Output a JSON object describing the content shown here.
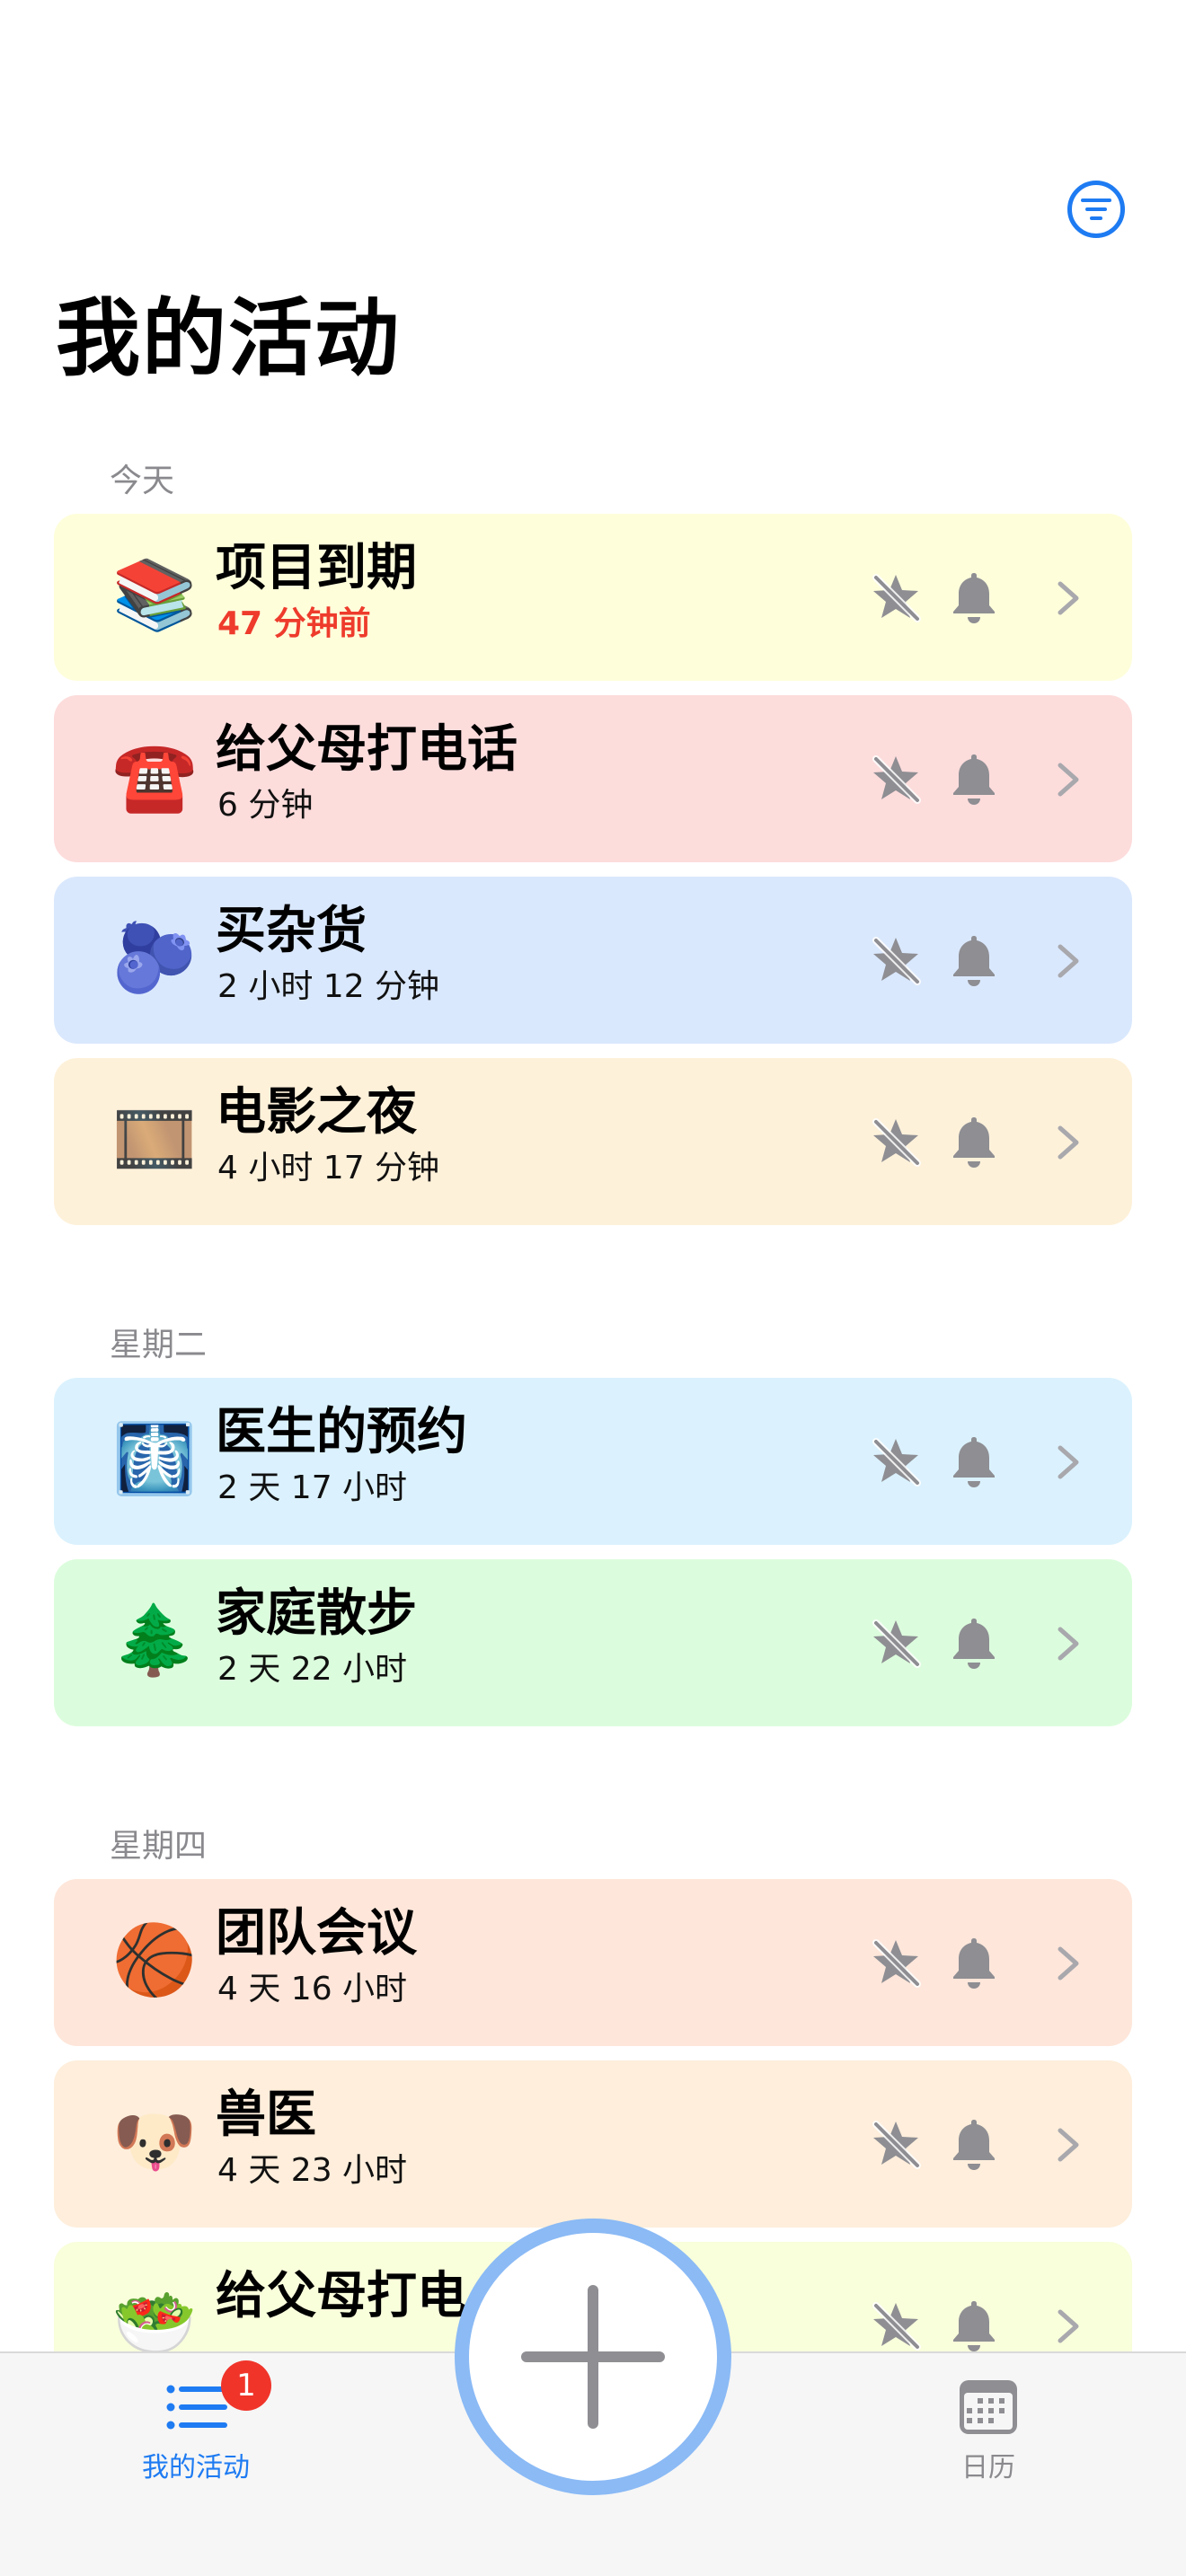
{
  "header": {
    "title": "我的活动",
    "filter_icon": "filter-list-icon"
  },
  "colors": {
    "accent": "#1E7BF2",
    "overdue": "#EE3B2C",
    "icon_gray": "#8E8E93"
  },
  "sections": [
    {
      "label": "今天",
      "items": [
        {
          "emoji": "📚",
          "title": "项目到期",
          "subtitle": "47 分钟前",
          "overdue": true,
          "bg": "#FEFEDB"
        },
        {
          "emoji": "☎️",
          "title": "给父母打电话",
          "subtitle": "6 分钟",
          "bg": "#FDDCDC"
        },
        {
          "emoji": "🫐",
          "title": "买杂货",
          "subtitle": "2 小时 12 分钟",
          "bg": "#DAE8FD"
        },
        {
          "emoji": "🎞️",
          "title": "电影之夜",
          "subtitle": "4 小时 17 分钟",
          "bg": "#FEF1DA"
        }
      ]
    },
    {
      "label": "星期二",
      "items": [
        {
          "emoji": "🩻",
          "title": "医生的预约",
          "subtitle": "2 天 17 小时",
          "bg": "#DBF2FE"
        },
        {
          "emoji": "🌲",
          "title": "家庭散步",
          "subtitle": "2 天 22 小时",
          "bg": "#DCFDDD"
        }
      ]
    },
    {
      "label": "星期四",
      "items": [
        {
          "emoji": "🏀",
          "title": "团队会议",
          "subtitle": "4 天 16 小时",
          "bg": "#FEE6DA"
        },
        {
          "emoji": "🐶",
          "title": "兽医",
          "subtitle": "4 天 23 小时",
          "bg": "#FEEEDB"
        },
        {
          "emoji": "🥗",
          "title": "给父母打电",
          "subtitle": "",
          "bg": "#F9FEDB"
        }
      ]
    }
  ],
  "row_icons": [
    "star-slash-icon",
    "bell-icon",
    "chevron-right-icon"
  ],
  "tab_bar": {
    "my_activities": {
      "label": "我的活动",
      "badge": "1",
      "icon": "list-icon"
    },
    "calendar": {
      "label": "日历",
      "icon": "calendar-icon"
    },
    "add_icon": "plus-icon"
  }
}
